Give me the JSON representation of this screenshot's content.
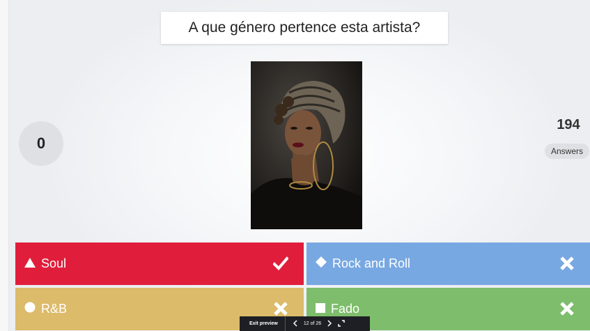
{
  "question": "A que género pertence esta artista?",
  "score": "0",
  "answers_count": "194",
  "answers_label": "Answers",
  "options": [
    {
      "label": "Soul",
      "shape": "triangle-icon",
      "result": "check-icon",
      "color": "#e01e3c"
    },
    {
      "label": "Rock and Roll",
      "shape": "diamond-icon",
      "result": "cross-icon",
      "color": "#78a8e2"
    },
    {
      "label": "R&B",
      "shape": "circle-icon",
      "result": "cross-icon",
      "color": "#dcbb6a"
    },
    {
      "label": "Fado",
      "shape": "square-icon",
      "result": "cross-icon",
      "color": "#7dbd6b"
    }
  ],
  "preview_bar": {
    "exit_label": "Exit preview",
    "page_indicator": "12 of 26"
  }
}
